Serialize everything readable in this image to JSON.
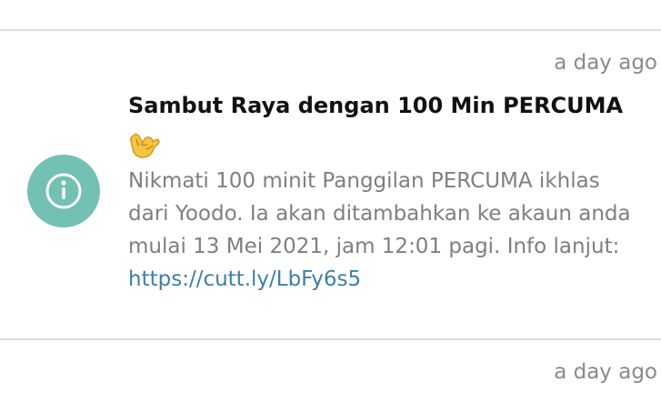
{
  "notification": {
    "timestamp": "a day ago",
    "title": "Sambut Raya dengan 100 Min PERCUMA",
    "emoji_icon": "call-me-hand-emoji",
    "body_lines": [
      "Nikmati 100 minit Panggilan PERCUMA ikhlas",
      "dari Yoodo. Ia akan ditambahkan ke akaun anda",
      "mulai 13 Mei 2021, jam 12:01 pagi. Info lanjut:"
    ],
    "link": "https://cutt.ly/LbFy6s5",
    "icon": "info-icon",
    "icon_color": "#73c0b5",
    "link_color": "#3f7fa6"
  },
  "next_notification": {
    "timestamp": "a day ago"
  }
}
